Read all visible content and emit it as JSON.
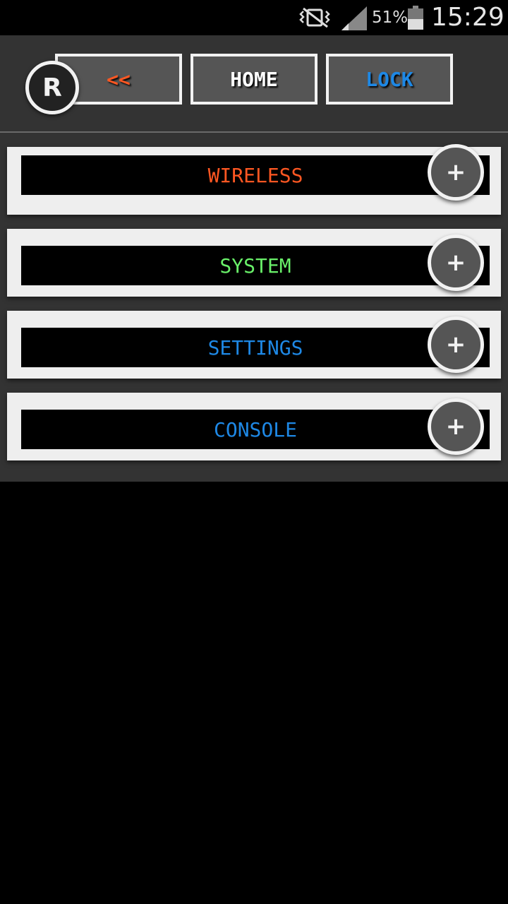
{
  "status_bar": {
    "battery": "51%",
    "time": "15:29",
    "icons": [
      "vibrate-off-icon",
      "signal-icon",
      "battery-icon"
    ]
  },
  "nav": {
    "back": {
      "label": "<<",
      "color": "#ff5722"
    },
    "home": {
      "label": "HOME",
      "color": "#ffffff"
    },
    "lock": {
      "label": "LOCK",
      "color": "#1e88e5"
    }
  },
  "logo": {
    "letter": "R"
  },
  "sections": [
    {
      "label": "WIRELESS",
      "color": "#ff5722",
      "action": "+"
    },
    {
      "label": "SYSTEM",
      "color": "#69f069",
      "action": "+"
    },
    {
      "label": "SETTINGS",
      "color": "#1e88e5",
      "action": "+"
    },
    {
      "label": "CONSOLE",
      "color": "#1e88e5",
      "action": "+"
    }
  ]
}
